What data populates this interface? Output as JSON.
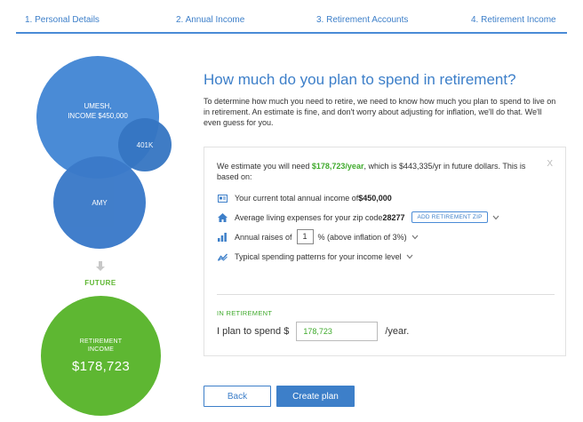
{
  "steps": [
    {
      "label": "1. Personal Details"
    },
    {
      "label": "2. Annual Income"
    },
    {
      "label": "3. Retirement Accounts"
    },
    {
      "label": "4. Retirement Income"
    }
  ],
  "bubbles": {
    "umesh_line1": "UMESH,",
    "umesh_line2": "INCOME $450,000",
    "k401": "401K",
    "amy": "AMY",
    "future": "FUTURE",
    "retirement_line1": "RETIREMENT",
    "retirement_line2": "INCOME",
    "retirement_amount": "$178,723"
  },
  "main": {
    "question": "How much do you plan to spend in retirement?",
    "intro": "To determine how much you need to retire, we need to know how much you plan to spend to live on in retirement.  An estimate is fine, and don't worry about adjusting for inflation, we'll do that.  We'll even guess for you."
  },
  "panel": {
    "estimate_prefix": "We estimate you will need ",
    "estimate_amount": "$178,723/year",
    "estimate_suffix": ", which is $443,335/yr in future dollars. This is based on:",
    "close": "X",
    "income_text": "Your current total annual income of ",
    "income_value": "$450,000",
    "living_text": "Average living expenses for your zip code ",
    "zip": "28277",
    "zip_button": "ADD RETIREMENT ZIP",
    "raises_prefix": "Annual raises of",
    "raises_value": "1",
    "raises_suffix": "% (above inflation of 3%)",
    "spending_text": "Typical spending patterns for your income level",
    "in_retirement": "IN RETIREMENT",
    "spend_prefix": "I plan to spend $",
    "spend_value": "178,723",
    "spend_suffix": "/year."
  },
  "buttons": {
    "back": "Back",
    "create": "Create plan"
  },
  "colors": {
    "blue": "#4a8bd6",
    "green": "#5eb732"
  },
  "icons": {
    "income": "id-card-icon",
    "living": "home-icon",
    "raises": "bar-chart-icon",
    "spending": "trend-line-icon",
    "arrow": "arrow-down-icon"
  }
}
